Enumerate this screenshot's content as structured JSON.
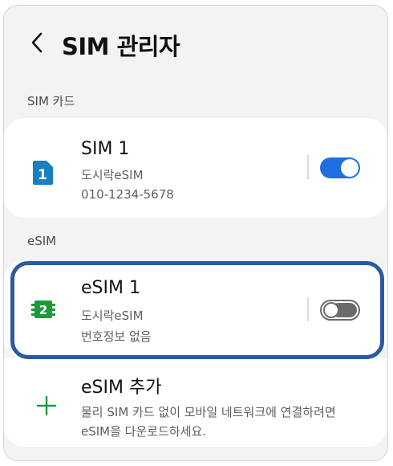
{
  "header": {
    "title": "SIM 관리자"
  },
  "sections": {
    "sim_card_label": "SIM 카드",
    "esim_label": "eSIM"
  },
  "sim1": {
    "icon_number": "1",
    "title": "SIM 1",
    "carrier": "도시락eSIM",
    "phone": "010-1234-5678",
    "enabled": true
  },
  "esim1": {
    "icon_number": "2",
    "title": "eSIM 1",
    "carrier": "도시락eSIM",
    "number_status": "번호정보 없음",
    "enabled": false
  },
  "add_esim": {
    "title": "eSIM 추가",
    "description": "물리 SIM 카드 없이 모바일 네트워크에 연결하려면 eSIM을 다운로드하세요."
  },
  "colors": {
    "toggle_on": "#1f6fe0",
    "sim1_icon": "#1a7fbf",
    "esim1_icon": "#1f9a3a",
    "add_icon": "#1f9a3a",
    "highlight": "#2c5aa0"
  }
}
